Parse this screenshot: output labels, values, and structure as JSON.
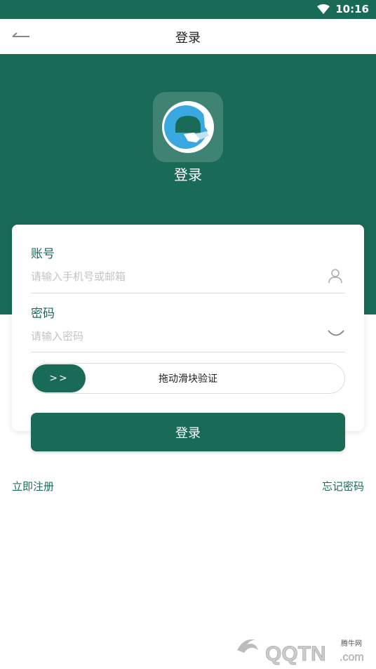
{
  "status": {
    "time": "10:16"
  },
  "nav": {
    "title": "登录"
  },
  "hero": {
    "title": "登录"
  },
  "form": {
    "account_label": "账号",
    "account_placeholder": "请输入手机号或邮箱",
    "password_label": "密码",
    "password_placeholder": "请输入密码",
    "slider_handle": ">>",
    "slider_text": "拖动滑块验证",
    "submit_label": "登录"
  },
  "links": {
    "register": "立即注册",
    "forgot": "忘记密码"
  },
  "watermark": {
    "text": "QQTN.com",
    "small": "腾牛网"
  },
  "colors": {
    "primary": "#1a6a58",
    "logo_bg": "#3f8373",
    "logo_accent": "#3aa8e0"
  }
}
